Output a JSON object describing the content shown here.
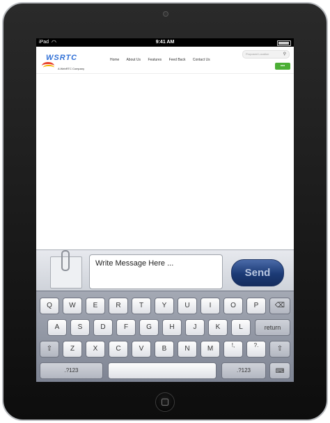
{
  "status_bar": {
    "carrier": "iPad",
    "wifi_icon": "wifi-icon",
    "time": "9:41 AM",
    "battery_icon": "battery-icon"
  },
  "website": {
    "logo_text": "WSRTC",
    "logo_tagline": "A WebRTC Company",
    "nav": [
      "Home",
      "About Us",
      "Features",
      "Feed Back",
      "Contact Us"
    ],
    "search_placeholder": "Proposed Location",
    "search_icon": "search-icon",
    "menu_icon": "grid-menu-icon",
    "accent_color": "#4caf36"
  },
  "chat": {
    "attach_icon": "paperclip-icon",
    "message_placeholder": "Write Message Here ...",
    "send_label": "Send",
    "send_color": "#1b3a75"
  },
  "keyboard": {
    "row1": [
      "Q",
      "W",
      "E",
      "R",
      "T",
      "Y",
      "U",
      "I",
      "O",
      "P"
    ],
    "backspace_icon": "backspace-icon",
    "row2": [
      "A",
      "S",
      "D",
      "F",
      "G",
      "H",
      "J",
      "K",
      "L"
    ],
    "return_label": "return",
    "shift_icon": "shift-icon",
    "row3": [
      "Z",
      "X",
      "C",
      "V",
      "B",
      "N",
      "M",
      "!,",
      "?."
    ],
    "numbers_label": ".?123",
    "dismiss_icon": "keyboard-dismiss-icon"
  }
}
